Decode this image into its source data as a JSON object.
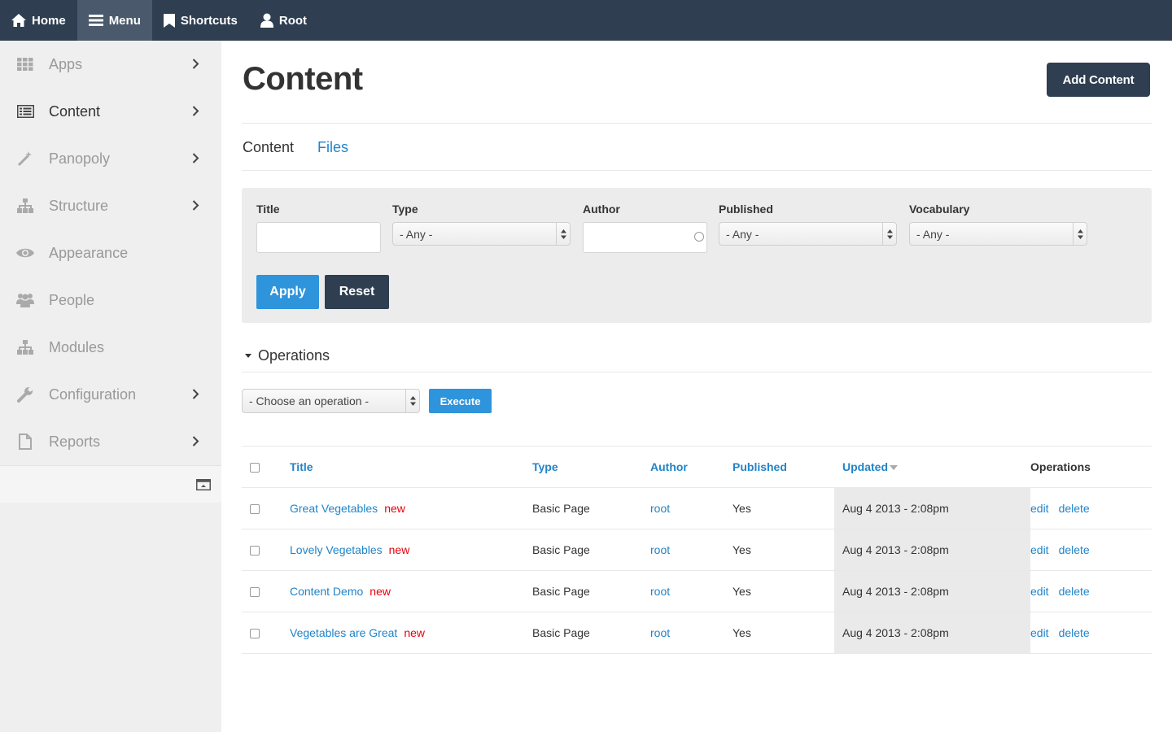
{
  "topbar": {
    "items": [
      {
        "label": "Home",
        "icon": "home-icon"
      },
      {
        "label": "Menu",
        "icon": "menu-icon"
      },
      {
        "label": "Shortcuts",
        "icon": "bookmark-icon"
      },
      {
        "label": "Root",
        "icon": "user-icon"
      }
    ],
    "active": "Menu"
  },
  "sidebar": {
    "items": [
      {
        "label": "Apps",
        "icon": "apps-grid-icon",
        "has_children": true
      },
      {
        "label": "Content",
        "icon": "content-list-icon",
        "has_children": true,
        "active": true
      },
      {
        "label": "Panopoly",
        "icon": "magic-wand-icon",
        "has_children": true
      },
      {
        "label": "Structure",
        "icon": "sitemap-icon",
        "has_children": true
      },
      {
        "label": "Appearance",
        "icon": "eye-icon",
        "has_children": false
      },
      {
        "label": "People",
        "icon": "people-icon",
        "has_children": false
      },
      {
        "label": "Modules",
        "icon": "modules-icon",
        "has_children": false
      },
      {
        "label": "Configuration",
        "icon": "wrench-icon",
        "has_children": true
      },
      {
        "label": "Reports",
        "icon": "document-icon",
        "has_children": true
      }
    ],
    "collapse_icon": "collapse-sidebar-icon"
  },
  "page": {
    "title": "Content",
    "add_button": "Add Content",
    "tabs": [
      {
        "label": "Content",
        "current": true
      },
      {
        "label": "Files",
        "current": false
      }
    ]
  },
  "filters": {
    "title": {
      "label": "Title",
      "value": ""
    },
    "type": {
      "label": "Type",
      "selected": "- Any -"
    },
    "author": {
      "label": "Author",
      "value": ""
    },
    "published": {
      "label": "Published",
      "selected": "- Any -"
    },
    "vocabulary": {
      "label": "Vocabulary",
      "selected": "- Any -"
    },
    "apply_label": "Apply",
    "reset_label": "Reset"
  },
  "operations": {
    "heading": "Operations",
    "select_value": "- Choose an operation -",
    "execute_label": "Execute"
  },
  "table": {
    "headers": {
      "title": "Title",
      "type": "Type",
      "author": "Author",
      "published": "Published",
      "updated": "Updated",
      "operations": "Operations"
    },
    "sorted_by": "Updated",
    "rows": [
      {
        "title": "Great Vegetables",
        "new": "new",
        "type": "Basic Page",
        "author": "root",
        "published": "Yes",
        "updated": "Aug 4 2013 - 2:08pm",
        "edit": "edit",
        "delete": "delete"
      },
      {
        "title": "Lovely Vegetables",
        "new": "new",
        "type": "Basic Page",
        "author": "root",
        "published": "Yes",
        "updated": "Aug 4 2013 - 2:08pm",
        "edit": "edit",
        "delete": "delete"
      },
      {
        "title": "Content Demo",
        "new": "new",
        "type": "Basic Page",
        "author": "root",
        "published": "Yes",
        "updated": "Aug 4 2013 - 2:08pm",
        "edit": "edit",
        "delete": "delete"
      },
      {
        "title": "Vegetables are Great",
        "new": "new",
        "type": "Basic Page",
        "author": "root",
        "published": "Yes",
        "updated": "Aug 4 2013 - 2:08pm",
        "edit": "edit",
        "delete": "delete"
      }
    ]
  },
  "colors": {
    "topbar_bg": "#2f3e51",
    "link": "#2184c8",
    "primary_button": "#2e94db",
    "new_marker": "#e8000d"
  }
}
